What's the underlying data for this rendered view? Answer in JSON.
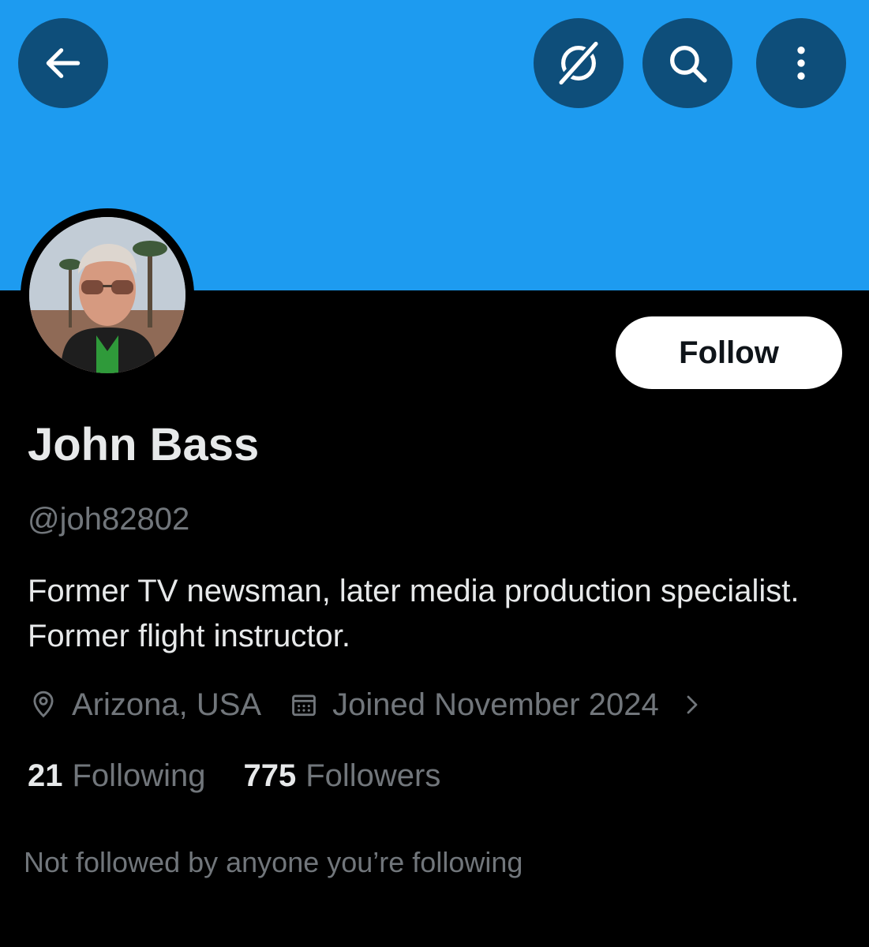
{
  "header": {
    "back_icon": "arrow-left-icon",
    "grok_icon": "grok-icon",
    "search_icon": "search-icon",
    "more_icon": "more-vertical-icon",
    "banner_color": "#1d9bf0"
  },
  "profile": {
    "display_name": "John Bass",
    "handle": "@joh82802",
    "bio": "Former TV newsman, later media production specialist. Former flight instructor.",
    "location": "Arizona, USA",
    "joined": "Joined November 2024",
    "follow_label": "Follow",
    "following_count": "21",
    "following_label": "Following",
    "followers_count": "775",
    "followers_label": "Followers",
    "followed_by_note": "Not followed by anyone you’re following"
  },
  "colors": {
    "background": "#000000",
    "text_primary": "#e7e9ea",
    "text_secondary": "#71767b",
    "button_bg": "#ffffff",
    "button_text": "#0f1419"
  }
}
